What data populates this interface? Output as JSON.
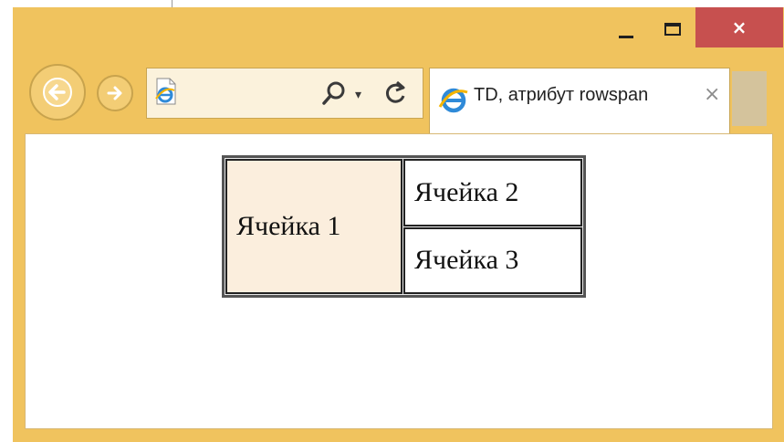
{
  "window": {
    "controls": {
      "minimize": "minimize",
      "maximize": "maximize",
      "close": "×"
    }
  },
  "browser": {
    "tab_title": "TD, атрибут rowspan",
    "tab_close": "×",
    "address_dropdown": "▾"
  },
  "page": {
    "table": {
      "cells": [
        "Ячейка 1",
        "Ячейка 2",
        "Ячейка 3"
      ]
    }
  },
  "colors": {
    "frame": "#f0c35e",
    "close_button": "#c7504f",
    "highlight_cell": "#fbeedd"
  }
}
